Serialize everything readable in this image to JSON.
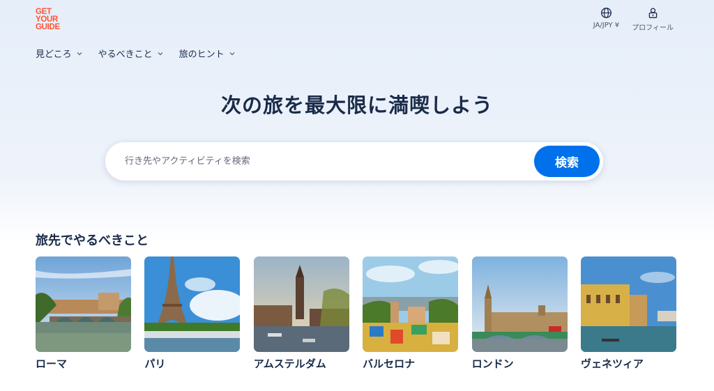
{
  "logo": {
    "line1": "GET",
    "line2": "YOUR",
    "line3": "GUIDE"
  },
  "header": {
    "language_label": "JA/JPY ¥",
    "profile_label": "プロフィール"
  },
  "nav": [
    {
      "label": "見どころ"
    },
    {
      "label": "やるべきこと"
    },
    {
      "label": "旅のヒント"
    }
  ],
  "hero": {
    "title": "次の旅を最大限に満喫しよう"
  },
  "search": {
    "placeholder": "行き先やアクティビティを検索",
    "value": "",
    "button_label": "検索"
  },
  "section": {
    "title": "旅先でやるべきこと"
  },
  "destinations": [
    {
      "name": "ローマ",
      "image_icon": "rome-bridge-photo"
    },
    {
      "name": "パリ",
      "image_icon": "eiffel-tower-photo"
    },
    {
      "name": "アムステルダム",
      "image_icon": "amsterdam-canal-photo"
    },
    {
      "name": "バルセロナ",
      "image_icon": "park-guell-photo"
    },
    {
      "name": "ロンドン",
      "image_icon": "westminster-photo"
    },
    {
      "name": "ヴェネツィア",
      "image_icon": "venice-canal-photo"
    }
  ],
  "colors": {
    "brand": "#ff5533",
    "accent": "#0071eb",
    "text": "#1a2b49"
  }
}
